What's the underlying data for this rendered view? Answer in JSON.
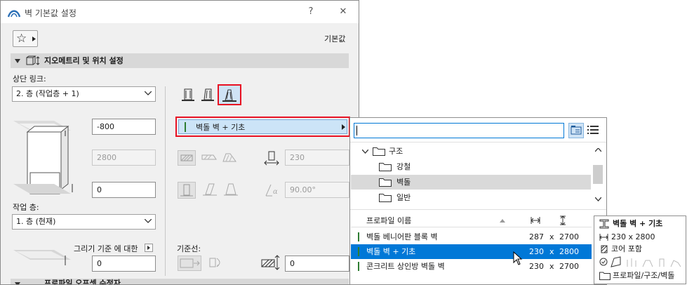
{
  "dialog": {
    "title": "벽 기본값 설정",
    "help": "?",
    "close": "✕",
    "favorites_star": "☆",
    "default_label": "기본값"
  },
  "geometry": {
    "section_title": "지오메트리 및 위치 설정",
    "top_link_label": "상단 링크:",
    "top_link_value": "2. 층 (작업층 + 1)",
    "top_offset": "-800",
    "height": "2800",
    "bottom_offset": "0",
    "home_story_label": "작업 층:",
    "home_story_value": "1. 층 (현재)",
    "relative_to_label": "그리기 기준 에 대한",
    "relative_offset": "0",
    "thickness": "230",
    "slant_angle": "90.00°",
    "reference_line_label": "기준선:",
    "ref_offset": "0"
  },
  "structure_selector": {
    "selected": "벽돌 벽 + 기초"
  },
  "next_section_title": "프로파일 오프셋 수정자",
  "popup": {
    "search_value": "",
    "tree": [
      {
        "label": "구조",
        "expanded": true,
        "selected": false
      },
      {
        "label": "강철",
        "selected": false
      },
      {
        "label": "벽돌",
        "selected": true
      },
      {
        "label": "일반",
        "selected": false
      }
    ],
    "list_header": "프로파일 이름",
    "list": [
      {
        "name": "벽돌 베니어판 블록 벽",
        "w": "287",
        "x": "x",
        "h": "2700",
        "selected": false
      },
      {
        "name": "벽돌 벽 + 기초",
        "w": "230",
        "x": "x",
        "h": "2800",
        "selected": true
      },
      {
        "name": "콘크리트 상인방 벽돌 벽",
        "w": "230",
        "x": "x",
        "h": "2700",
        "selected": false
      }
    ]
  },
  "tooltip": {
    "name": "벽돌 벽 + 기초",
    "size": "230 x 2800",
    "core": "코어 포함",
    "path": "프로파일/구조/벽돌"
  },
  "colors": {
    "accent_selection": "#0078d7",
    "highlight_border": "#e81123",
    "selected_field": "#cce4f7",
    "tree_selection": "#d9d9d9",
    "profile_marker": "#2e7d32"
  }
}
